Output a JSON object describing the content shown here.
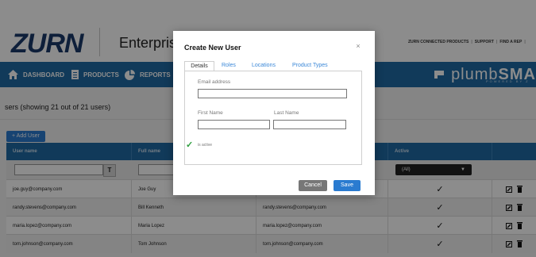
{
  "header": {
    "logo": "ZURN",
    "title": "Enterprise",
    "util_links": [
      "ZURN CONNECTED PRODUCTS",
      "SUPPORT",
      "FIND A REP"
    ]
  },
  "nav": {
    "items": [
      {
        "label": "DASHBOARD",
        "icon": "home-icon"
      },
      {
        "label": "PRODUCTS",
        "icon": "document-icon"
      },
      {
        "label": "REPORTS",
        "icon": "pie-chart-icon"
      }
    ],
    "brand_prefix": "plumb",
    "brand_bold": "SMA",
    "brand_sub": "POWERED BY Z"
  },
  "users": {
    "title": "sers (showing 21 out of 21 users)",
    "add_button": "+ Add User",
    "columns": [
      "User name",
      "Full name",
      "",
      "Active",
      ""
    ],
    "active_filter": "(All)",
    "filter_icon_label": "T",
    "rows": [
      {
        "username": "joe.guy@company.com",
        "fullname": "Joe Guy",
        "email": "",
        "active": "✓"
      },
      {
        "username": "randy.stevens@company.com",
        "fullname": "Bill Kenneth",
        "email": "randy.stevens@company.com",
        "active": "✓"
      },
      {
        "username": "maria.lopez@company.com",
        "fullname": "Maria Lopez",
        "email": "maria.lopez@company.com",
        "active": "✓"
      },
      {
        "username": "tom.johnson@company.com",
        "fullname": "Tom Johnson",
        "email": "tom.johnson@company.com",
        "active": "✓"
      }
    ]
  },
  "modal": {
    "title": "Create New User",
    "close": "×",
    "tabs": [
      "Details",
      "Roles",
      "Locations",
      "Product Types"
    ],
    "email_label": "Email address",
    "email_value": "",
    "first_name_label": "First Name",
    "first_name_value": "",
    "last_name_label": "Last Name",
    "last_name_value": "",
    "active_check": "✓",
    "active_label": "is active",
    "cancel": "Cancel",
    "save": "Save"
  },
  "colors": {
    "brand_blue": "#1f6aa5",
    "button_blue": "#2a7bd0",
    "check_green": "#2e9e3e"
  }
}
